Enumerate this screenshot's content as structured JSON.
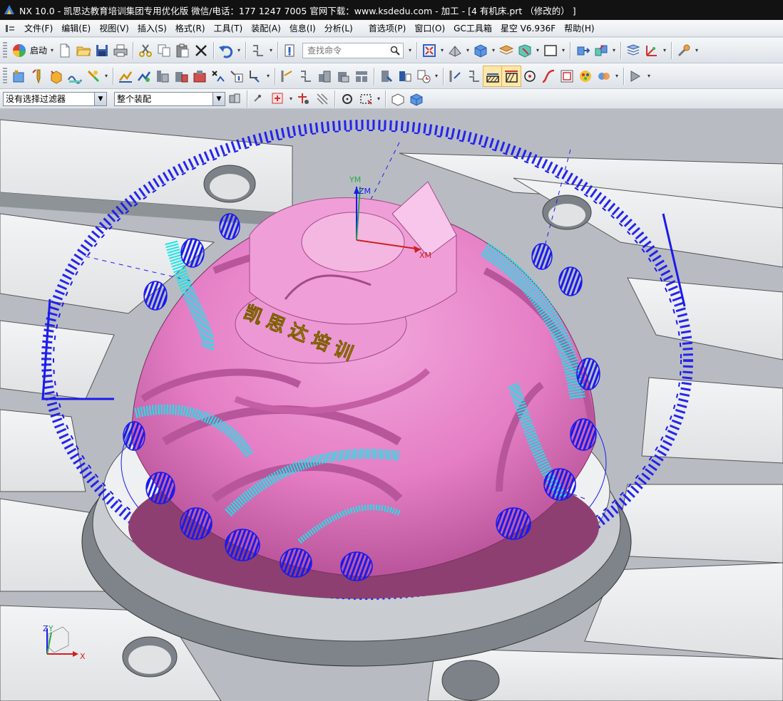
{
  "window": {
    "title": "NX 10.0 - 凯思达教育培训集团专用优化版 微信/电话：177 1247 7005    官网下载：www.ksdedu.com - 加工 - [4 有机床.prt  （修改的）  ]"
  },
  "menu": {
    "items": [
      "文件(F)",
      "编辑(E)",
      "视图(V)",
      "插入(S)",
      "格式(R)",
      "工具(T)",
      "装配(A)",
      "信息(I)",
      "分析(L)"
    ],
    "items_right": [
      "首选项(P)",
      "窗口(O)",
      "GC工具箱",
      "星空 V6.936F",
      "帮助(H)"
    ]
  },
  "toolbar": {
    "start_label": "启动",
    "command_search_placeholder": "查找命令"
  },
  "selection_bar": {
    "filter_value": "没有选择过滤器",
    "scope_value": "整个装配"
  },
  "viewport": {
    "engraved_text": "凯思达培训",
    "wcs_labels": {
      "y": "YM",
      "z": "ZM",
      "x": "XM"
    },
    "triad_labels": {
      "z": "Z",
      "y": "Y",
      "x": "X"
    },
    "colors": {
      "part": "#e77fc8",
      "toolpath_cut": "#19e6e8",
      "toolpath_rapid": "#1a1aee",
      "table": "#eeeff0",
      "engrave": "#e9c232"
    }
  }
}
